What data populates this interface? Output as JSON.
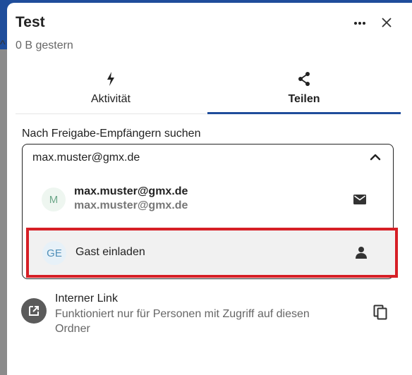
{
  "panel": {
    "title": "Test",
    "subtitle": "0 B gestern"
  },
  "header": {
    "more_icon": "more-horizontal-icon",
    "close_icon": "close-icon"
  },
  "tabs": [
    {
      "label": "Aktivität",
      "icon": "lightning-icon",
      "active": false
    },
    {
      "label": "Teilen",
      "icon": "share-icon",
      "active": true
    }
  ],
  "share": {
    "search_label": "Nach Freigabe-Empfängern suchen",
    "search_value": "max.muster@gmx.de",
    "results": [
      {
        "avatar": "M",
        "name": "max.muster@gmx.de",
        "subtitle": "max.muster@gmx.de",
        "icon": "mail-icon"
      },
      {
        "avatar": "GE",
        "name": "Gast einladen",
        "icon": "person-icon",
        "highlighted": true
      }
    ]
  },
  "internal_link": {
    "title": "Interner Link",
    "description": "Funktioniert nur für Personen mit Zugriff auf diesen Ordner",
    "icon": "open-external-icon",
    "action_icon": "copy-icon"
  },
  "colors": {
    "accent": "#1f4d9b",
    "highlight_border": "#d61f26"
  }
}
